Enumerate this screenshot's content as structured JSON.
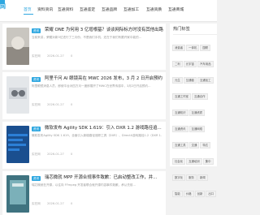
{
  "nav": {
    "logo": "网",
    "items": [
      "首页",
      "资料资讯",
      "互通资料",
      "互通鉴定",
      "互通品牌",
      "互通加工",
      "互通资质",
      "互通商城"
    ]
  },
  "posts": [
    {
      "tag": "资讯",
      "title": "荣耀 ONE 为何用 3 亿增根基？谈谈网际标方时没有其他出路",
      "excerpt": "当前来讲，荣耀对新3亿进行了三月份，不是我们手机，还在于我们有跟许家中能的...",
      "author": "实在网",
      "date": "2026-01-27",
      "views": "0",
      "thumb_color": "#b8b4ad"
    },
    {
      "tag": "资讯",
      "title": "阿里千问 AI 眼镜亮在 MWC 2026 发布，3 月 2 日开启预约",
      "excerpt": "阿里眼镜消息人员，即使平台对四方月一度即展开了MWC在世界传感中，3月2日开启预约...",
      "author": "实在网",
      "date": "2026-01-27",
      "views": "0",
      "thumb_color": "#d9dde2"
    },
    {
      "tag": "资讯",
      "title": "微软发布 Agility SDK 1.619：引入 DXR 1.2 游戏路径追...",
      "excerpt": "微软发布Agility SDK 1.619，全面引入新增路径追踪工具（DXR）、DirectX游戏路径1.2（DXR 1.2）...",
      "author": "实在网",
      "date": "2026-01-27",
      "views": "0",
      "thumb_color": "#1f5fa8"
    },
    {
      "tag": "资讯",
      "title": "瑞芯微就 MPP 开源合规事件致歉：已启动整改工作，并...",
      "excerpt": "瑞芯微就在开源，以往向 FFmpeg 开发者联合就开源内容事件致歉，承认先前...",
      "author": "实在网",
      "date": "2026-01-27",
      "views": "0",
      "thumb_color": "#5a8f9a"
    }
  ],
  "sidebar": {
    "title": "热门标签",
    "tags": [
      "消费者",
      "一体机",
      "国联",
      "二利",
      "元宇宙",
      "汽车用品",
      "元生",
      "互通链",
      "互通加工",
      "互通工作室",
      "互通合作",
      "互通知识",
      "互通资质",
      "互通资讯",
      "互通网络",
      "互通工具",
      "交通",
      "特达",
      "社会化",
      "互通培训",
      "集中",
      "数字化",
      "服务",
      "新闻",
      "智能",
      "价格",
      "创新",
      "出口"
    ],
    "accent": "#2ea7e0"
  }
}
